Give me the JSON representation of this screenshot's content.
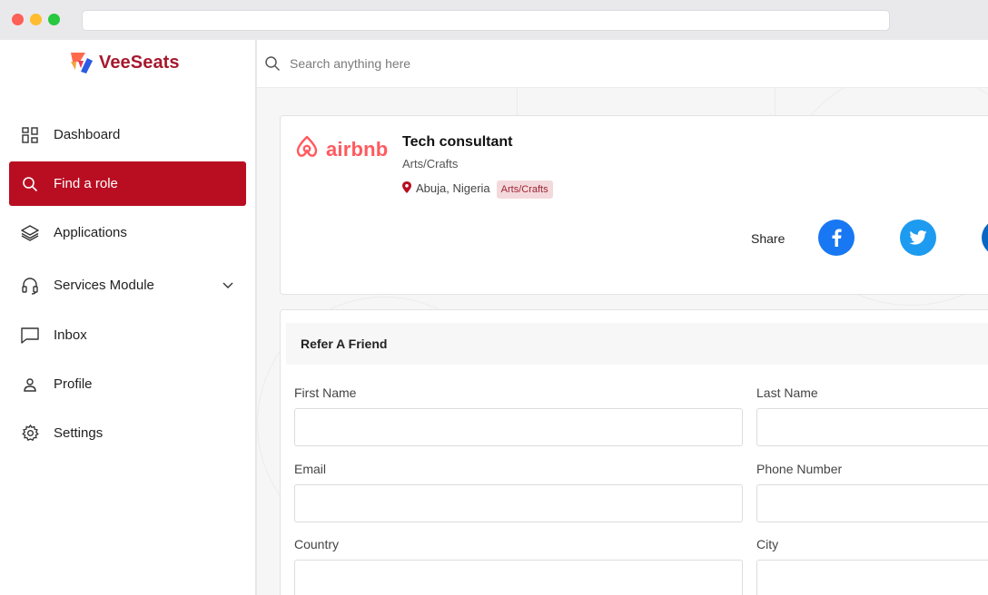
{
  "app": {
    "name": "VeeSeats"
  },
  "search": {
    "placeholder": "Search anything here"
  },
  "sidebar": {
    "items": [
      {
        "label": "Dashboard",
        "icon": "dashboard-grid-icon"
      },
      {
        "label": "Find a role",
        "icon": "search-icon",
        "active": true
      },
      {
        "label": "Applications",
        "icon": "layers-icon"
      },
      {
        "label": "Services Module",
        "icon": "headset-icon",
        "expandable": true
      },
      {
        "label": "Inbox",
        "icon": "chat-bubble-icon"
      },
      {
        "label": "Profile",
        "icon": "user-icon"
      },
      {
        "label": "Settings",
        "icon": "gear-icon"
      }
    ]
  },
  "job": {
    "company": "airbnb",
    "title": "Tech consultant",
    "category": "Arts/Crafts",
    "location": "Abuja, Nigeria",
    "tag": "Arts/Crafts",
    "share_label": "Share"
  },
  "refer": {
    "title": "Refer A Friend",
    "fields": {
      "first_name": {
        "label": "First Name",
        "value": ""
      },
      "last_name": {
        "label": "Last Name",
        "value": ""
      },
      "email": {
        "label": "Email",
        "value": ""
      },
      "phone": {
        "label": "Phone Number",
        "value": ""
      },
      "country": {
        "label": "Country",
        "value": ""
      },
      "city": {
        "label": "City",
        "value": ""
      }
    }
  },
  "colors": {
    "brand": "#a6192e",
    "active_nav": "#b90e22",
    "airbnb": "#ff5a5f",
    "facebook": "#1877f2",
    "twitter": "#1d9bf0",
    "linkedin": "#0a66c2"
  }
}
